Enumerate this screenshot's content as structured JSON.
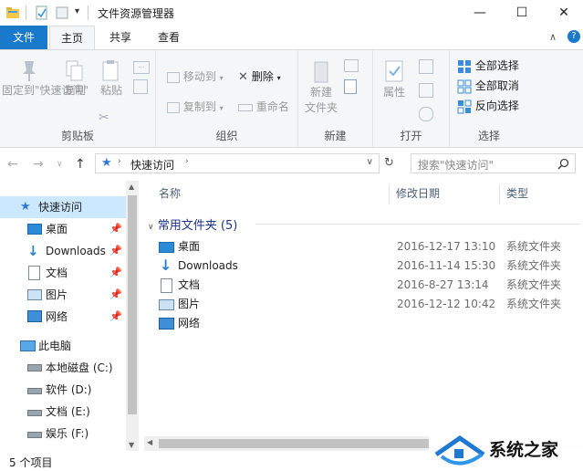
{
  "window": {
    "title": "文件资源管理器",
    "minimize": "—",
    "maximize": "☐",
    "close": "✕"
  },
  "tabs": [
    {
      "label": "文件"
    },
    {
      "label": "主页"
    },
    {
      "label": "共享"
    },
    {
      "label": "查看"
    }
  ],
  "ribbon": {
    "clipboard": {
      "pin_quick": "固定到\"快速访问\"",
      "copy": "复制",
      "paste": "粘贴",
      "label": "剪贴板"
    },
    "organize": {
      "move_to": "移动到",
      "copy_to": "复制到",
      "delete": "删除",
      "rename": "重命名",
      "label": "组织"
    },
    "new": {
      "new_folder": "新建\n文件夹",
      "label": "新建"
    },
    "open": {
      "properties": "属性",
      "label": "打开"
    },
    "select": {
      "select_all": "全部选择",
      "select_none": "全部取消",
      "invert": "反向选择",
      "label": "选择"
    }
  },
  "address": {
    "path": "快速访问",
    "search_placeholder": "搜索\"快速访问\""
  },
  "nav": {
    "quick_access": "快速访问",
    "items": [
      {
        "label": "桌面"
      },
      {
        "label": "Downloads"
      },
      {
        "label": "文档"
      },
      {
        "label": "图片"
      },
      {
        "label": "网络"
      }
    ],
    "this_pc": "此电脑",
    "drives": [
      {
        "label": "本地磁盘 (C:)"
      },
      {
        "label": "软件 (D:)"
      },
      {
        "label": "文档 (E:)"
      },
      {
        "label": "娱乐 (F:)"
      }
    ]
  },
  "content": {
    "columns": {
      "name": "名称",
      "modified": "修改日期",
      "type": "类型"
    },
    "group_header": "常用文件夹 (5)",
    "rows": [
      {
        "name": "桌面",
        "modified": "2016-12-17 13:10",
        "type": "系统文件夹"
      },
      {
        "name": "Downloads",
        "modified": "2016-11-14 15:30",
        "type": "系统文件夹"
      },
      {
        "name": "文档",
        "modified": "2016-8-27 13:14",
        "type": "系统文件夹"
      },
      {
        "name": "图片",
        "modified": "2016-12-12 10:42",
        "type": "系统文件夹"
      },
      {
        "name": "网络",
        "modified": "",
        "type": ""
      }
    ]
  },
  "status": {
    "count": "5 个项目"
  },
  "watermark": {
    "text": "系统之家"
  },
  "colors": {
    "accent": "#1979ca",
    "selection": "#cce8ff"
  }
}
